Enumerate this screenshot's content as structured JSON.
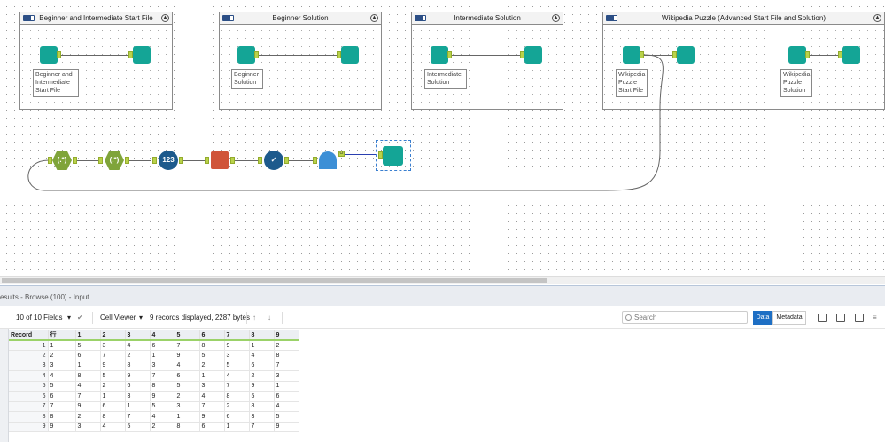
{
  "workflow": {
    "containers": [
      {
        "title": "Beginner and Intermediate Start File",
        "labels": [
          "Beginner and Intermediate Start File"
        ]
      },
      {
        "title": "Beginner Solution",
        "labels": [
          "Beginner Solution"
        ]
      },
      {
        "title": "Intermediate Solution",
        "labels": [
          "Intermediate Solution"
        ]
      },
      {
        "title": "Wikipedia Puzzle (Advanced Start File and Solution)",
        "labels": [
          "Wikipedia Puzzle Start File",
          "Wikipedia Puzzle Solution"
        ]
      }
    ],
    "output_anchor_label": "O",
    "collapse_glyph": "▲"
  },
  "results": {
    "title": "esults - Browse (100) - Input",
    "fields_label": "10 of 10 Fields",
    "viewer_label": "Cell Viewer",
    "records_info": "9 records displayed, 2287 bytes",
    "search_placeholder": "Search",
    "data_button": "Data",
    "metadata_button": "Metadata",
    "colors": {
      "accent": "#1e6fc4",
      "header_underline": "#9bd269",
      "tool_teal": "#14a596"
    },
    "columns": [
      "Record",
      "行",
      "1",
      "2",
      "3",
      "4",
      "5",
      "6",
      "7",
      "8",
      "9"
    ],
    "rows": [
      [
        "1",
        "1",
        "5",
        "3",
        "4",
        "6",
        "7",
        "8",
        "9",
        "1",
        "2"
      ],
      [
        "2",
        "2",
        "6",
        "7",
        "2",
        "1",
        "9",
        "5",
        "3",
        "4",
        "8"
      ],
      [
        "3",
        "3",
        "1",
        "9",
        "8",
        "3",
        "4",
        "2",
        "5",
        "6",
        "7"
      ],
      [
        "4",
        "4",
        "8",
        "5",
        "9",
        "7",
        "6",
        "1",
        "4",
        "2",
        "3"
      ],
      [
        "5",
        "5",
        "4",
        "2",
        "6",
        "8",
        "5",
        "3",
        "7",
        "9",
        "1"
      ],
      [
        "6",
        "6",
        "7",
        "1",
        "3",
        "9",
        "2",
        "4",
        "8",
        "5",
        "6"
      ],
      [
        "7",
        "7",
        "9",
        "6",
        "1",
        "5",
        "3",
        "7",
        "2",
        "8",
        "4"
      ],
      [
        "8",
        "8",
        "2",
        "8",
        "7",
        "4",
        "1",
        "9",
        "6",
        "3",
        "5"
      ],
      [
        "9",
        "9",
        "3",
        "4",
        "5",
        "2",
        "8",
        "6",
        "1",
        "7",
        "9"
      ]
    ]
  }
}
